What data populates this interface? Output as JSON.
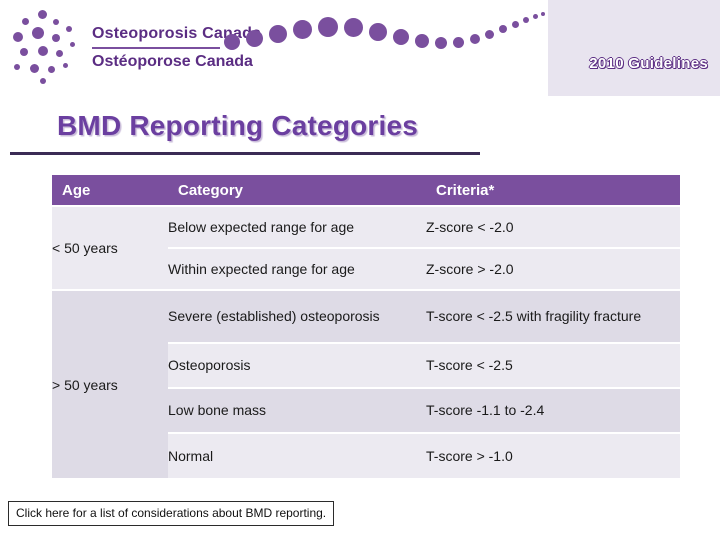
{
  "header": {
    "logo_line1": "Osteoporosis Canada",
    "logo_line2": "Ostéoporose Canada",
    "guidelines_badge": "2010 Guidelines"
  },
  "title": "BMD Reporting Categories",
  "table": {
    "columns": [
      "Age",
      "Category",
      "Criteria*"
    ],
    "groups": [
      {
        "age": "< 50 years",
        "rows": [
          {
            "category": "Below expected range for age",
            "criteria": "Z-score < -2.0"
          },
          {
            "category": "Within expected range for age",
            "criteria": "Z-score > -2.0"
          }
        ]
      },
      {
        "age": "> 50 years",
        "rows": [
          {
            "category": "Severe (established) osteoporosis",
            "criteria": "T-score < -2.5 with fragility fracture"
          },
          {
            "category": "Osteoporosis",
            "criteria": "T-score < -2.5"
          },
          {
            "category": "Low bone mass",
            "criteria": "T-score -1.1 to -2.4"
          },
          {
            "category": "Normal",
            "criteria": "T-score > -1.0"
          }
        ]
      }
    ]
  },
  "footer": {
    "note": "Click here for a list of considerations about BMD reporting."
  }
}
